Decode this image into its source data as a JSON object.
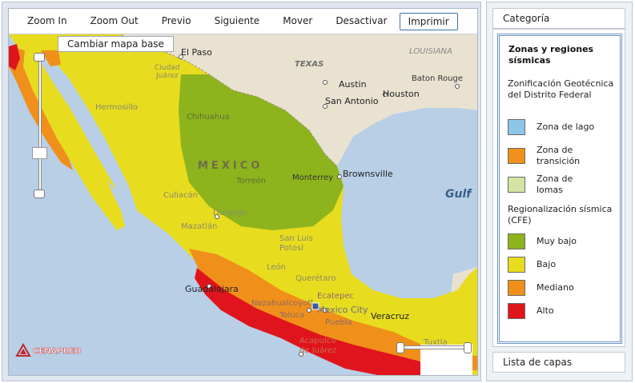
{
  "toolbar": {
    "zoom_in": "Zoom In",
    "zoom_out": "Zoom Out",
    "previous": "Previo",
    "next": "Siguiente",
    "move": "Mover",
    "deactivate": "Desactivar",
    "print": "Imprimir"
  },
  "basemap": {
    "label": "Cambiar mapa base"
  },
  "map": {
    "water_color": "#b8cfe6",
    "land_color": "#e9e2d0",
    "labels": {
      "el_paso": "El Paso",
      "ciudad_juarez": "Ciudad\nJuárez",
      "texas": "TEXAS",
      "louisiana": "LOUISIANA",
      "baton_rouge": "Baton Rouge",
      "austin": "Austin",
      "houston": "Houston",
      "san_antonio": "San Antonio",
      "hermosillo": "Hermosillo",
      "chihuahua": "Chihuahua",
      "mexico": "MEXICO",
      "torreon": "Torreón",
      "monterrey": "Monterrey",
      "brownsville": "Brownsville",
      "gulf": "Gulf",
      "culiacan": "Culiacán",
      "durango": "Durango",
      "mazatlan": "Mazatlán",
      "san_luis_potosi": "San Luis\nPotosí",
      "leon": "León",
      "queretaro": "Querétaro",
      "guadalajara": "Guadalajara",
      "nezahualcoyotl": "Nezahualcoyotl",
      "ecatepec": "Ecatepec",
      "mexico_city": "Mexico City",
      "toluca": "Toluca",
      "puebla": "Puebla",
      "veracruz": "Veracruz",
      "acapulco": "Acapulco\nde Juárez",
      "tuxtla": "Tuxtla"
    },
    "logo": "CENAPRED"
  },
  "legend": {
    "header": "Categoría",
    "title": "Zonas y regiones sísmicas",
    "section1": "Zonificación Geotécnica del Distrito Federal",
    "items1": [
      {
        "label": "Zona de lago",
        "color": "#8ec5e8"
      },
      {
        "label": "Zona de transición",
        "color": "#f0901a"
      },
      {
        "label": "Zona de lomas",
        "color": "#d5e4a2"
      }
    ],
    "section2": "Regionalización sísmica (CFE)",
    "items2": [
      {
        "label": "Muy bajo",
        "color": "#8db41c"
      },
      {
        "label": "Bajo",
        "color": "#e8dc1e"
      },
      {
        "label": "Mediano",
        "color": "#f0901a"
      },
      {
        "label": "Alto",
        "color": "#e0141c"
      }
    ],
    "footer": "Lista de capas"
  }
}
